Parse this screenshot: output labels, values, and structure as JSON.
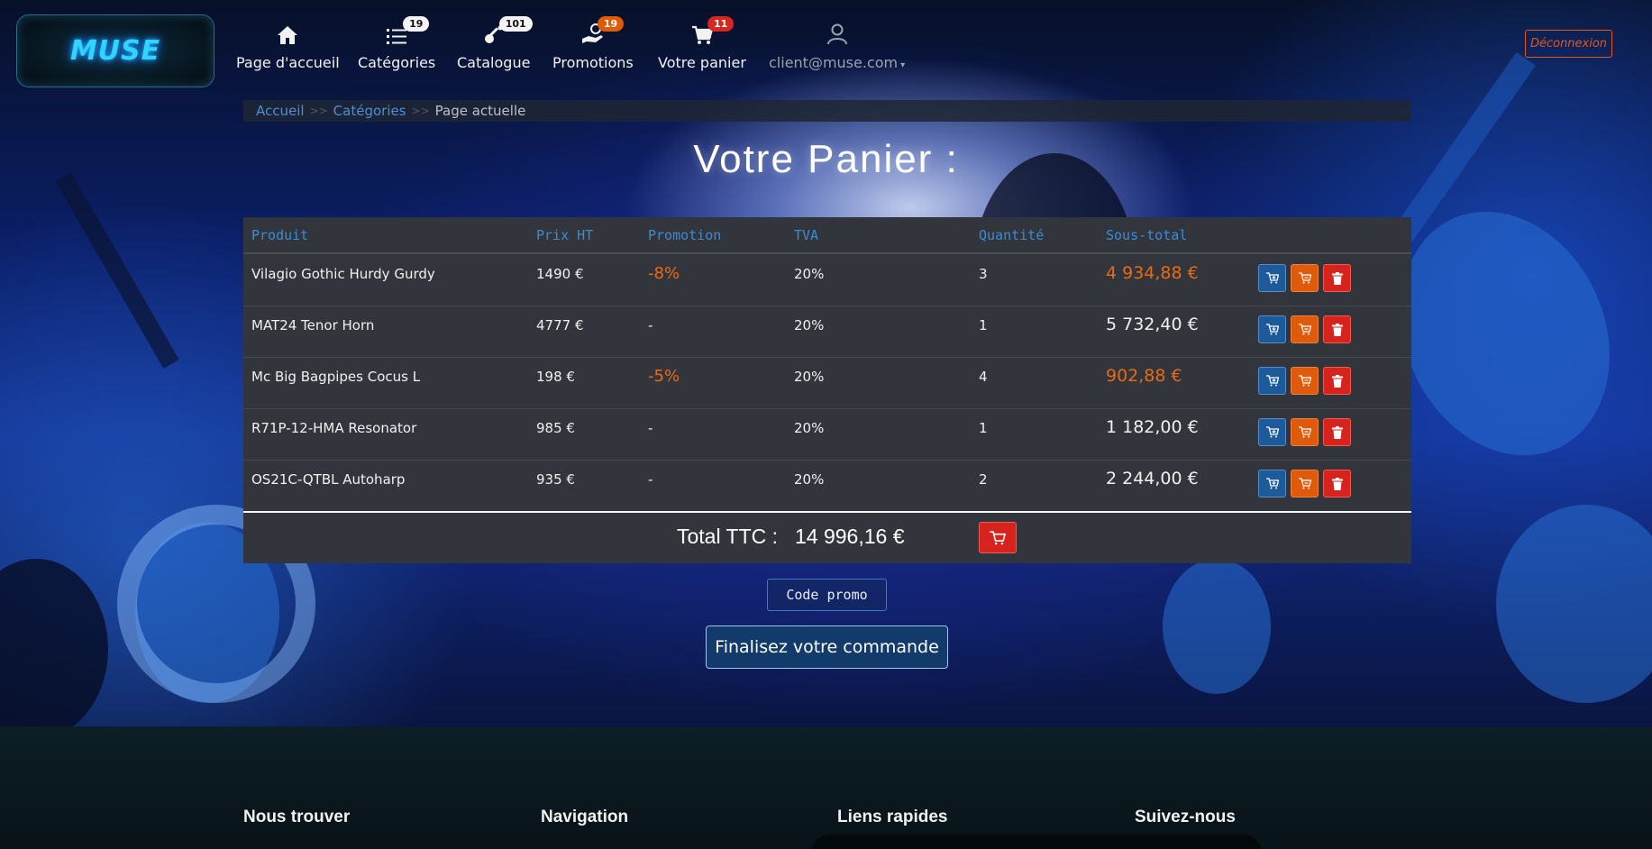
{
  "brand": {
    "logo_text": "MUSE"
  },
  "nav": {
    "items": [
      {
        "label": "Page d'accueil",
        "icon": "home-icon",
        "badge": null
      },
      {
        "label": "Catégories",
        "icon": "list-icon",
        "badge": "19"
      },
      {
        "label": "Catalogue",
        "icon": "guitar-icon",
        "badge": "101"
      },
      {
        "label": "Promotions",
        "icon": "hand-coin-icon",
        "badge": "19"
      },
      {
        "label": "Votre panier",
        "icon": "cart-icon",
        "badge": "11"
      }
    ],
    "user": {
      "label": "client@muse.com",
      "icon": "user-icon"
    },
    "logout_label": "Déconnexion"
  },
  "breadcrumb": {
    "home": "Accueil",
    "categories": "Catégories",
    "current": "Page actuelle",
    "sep": ">>"
  },
  "page_title": "Votre Panier :",
  "cart": {
    "headers": [
      "Produit",
      "Prix HT",
      "Promotion",
      "TVA",
      "Quantité",
      "Sous-total"
    ],
    "rows": [
      {
        "product": "Vilagio Gothic Hurdy Gurdy",
        "price": "1490 €",
        "promo": "-8%",
        "tva": "20%",
        "qty": "3",
        "subtotal": "4 934,88 €"
      },
      {
        "product": "MAT24 Tenor Horn",
        "price": "4777 €",
        "promo": "-",
        "tva": "20%",
        "qty": "1",
        "subtotal": "5 732,40 €"
      },
      {
        "product": "Mc Big Bagpipes Cocus L",
        "price": "198 €",
        "promo": "-5%",
        "tva": "20%",
        "qty": "4",
        "subtotal": "902,88 €"
      },
      {
        "product": "R71P-12-HMA Resonator",
        "price": "985 €",
        "promo": "-",
        "tva": "20%",
        "qty": "1",
        "subtotal": "1 182,00 €"
      },
      {
        "product": "OS21C-QTBL Autoharp",
        "price": "935 €",
        "promo": "-",
        "tva": "20%",
        "qty": "2",
        "subtotal": "2 244,00 €"
      }
    ],
    "total_label": "Total TTC :",
    "total_value": "14 996,16 €"
  },
  "actions": {
    "promo_code": "Code promo",
    "checkout": "Finalisez votre commande"
  },
  "footer": {
    "sections": [
      "Nous trouver",
      "Navigation",
      "Liens rapides",
      "Suivez-nous"
    ]
  },
  "colors": {
    "accent_blue": "#3a8bd6",
    "promo_orange": "#e86a12",
    "danger_red": "#d7231d",
    "table_bg": "#32363c"
  }
}
